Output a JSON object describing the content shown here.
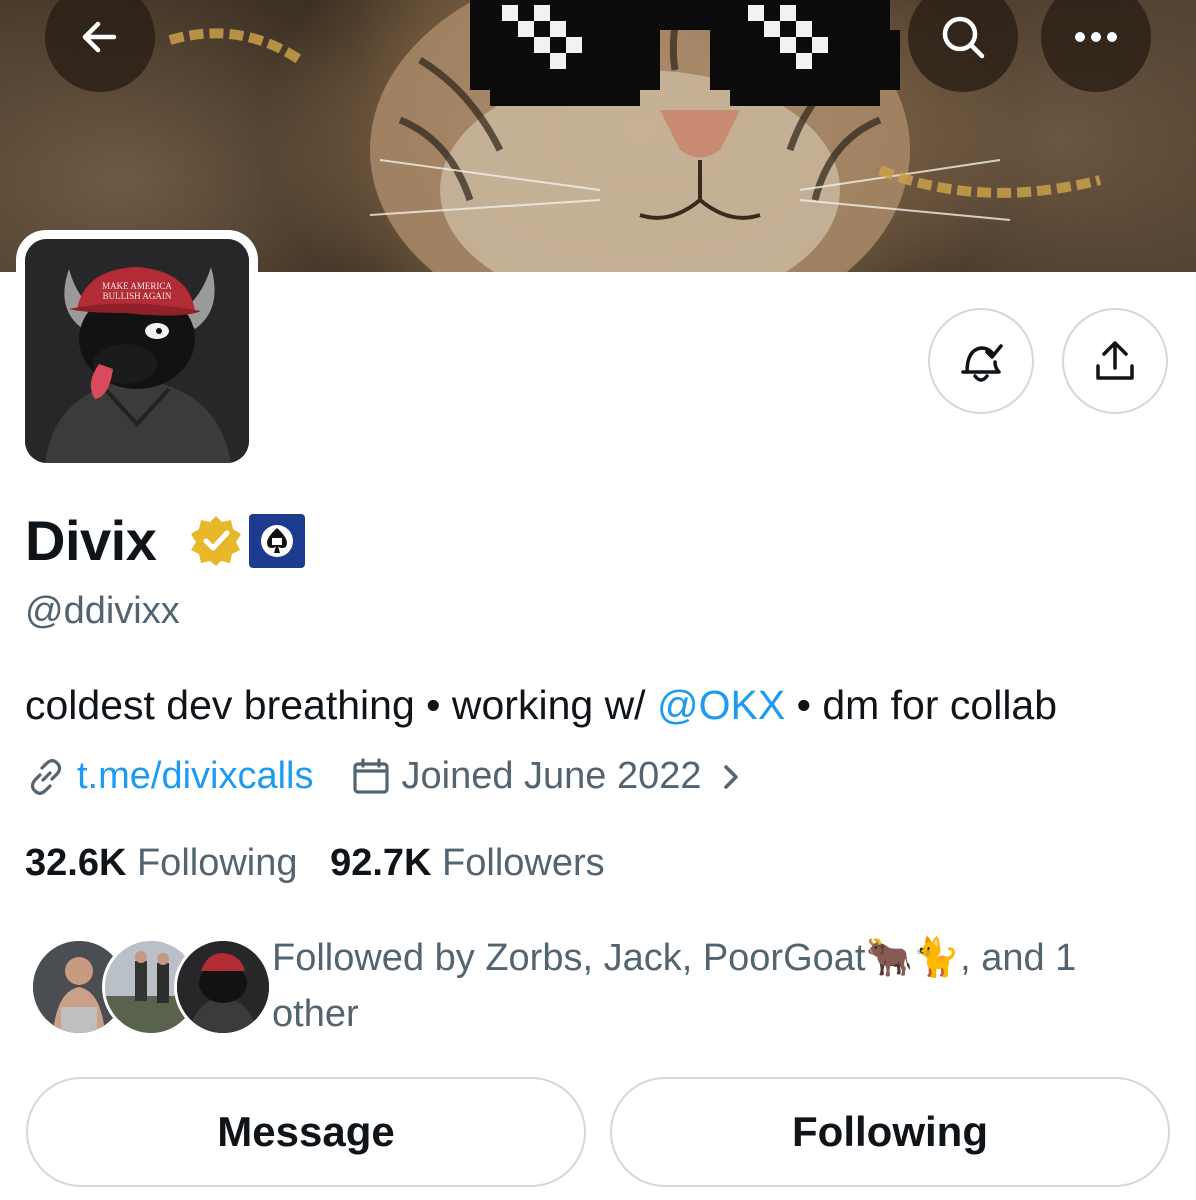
{
  "header": {
    "back_icon": "arrow-left-icon",
    "search_icon": "search-icon",
    "more_icon": "more-horizontal-icon"
  },
  "profile": {
    "name": "Divix",
    "handle": "@ddivixx",
    "avatar_hat_text": "MAKE AMERICA BULLISH AGAIN",
    "bio_part1": "coldest dev breathing • working w/ ",
    "bio_mention": "@OKX",
    "bio_part2": " • dm for collab",
    "link": "t.me/divixcalls",
    "joined": "Joined June 2022",
    "following_count": "32.6K",
    "following_label": "Following",
    "followers_count": "92.7K",
    "followers_label": "Followers",
    "followed_by": "Followed by Zorbs, Jack, PoorGoat🐂🐈, and 1 other"
  },
  "actions": {
    "message": "Message",
    "following": "Following"
  },
  "colors": {
    "accent": "#1d9bf0",
    "secondary_text": "#536471",
    "primary_text": "#0f1419",
    "verified_gold": "#e8b82a",
    "affiliate_blue": "#1d3c8f"
  }
}
